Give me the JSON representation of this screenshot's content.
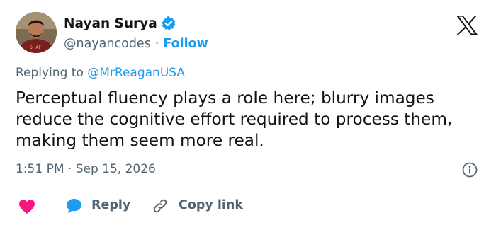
{
  "author": {
    "name": "Nayan Surya",
    "handle": "@nayancodes",
    "separator": "·",
    "follow_label": "Follow",
    "shirt_text": "SHAF"
  },
  "reply_context": {
    "prefix": "Replying to ",
    "mention": "@MrReaganUSA"
  },
  "tweet": {
    "text": "Perceptual fluency plays a role here; blurry images reduce the cognitive effort required to process them, making them seem more real.",
    "timestamp": "1:51 PM · Sep 15, 2026"
  },
  "actions": {
    "reply_label": "Reply",
    "copy_link_label": "Copy link"
  },
  "icons": {
    "verified": "verified-badge-icon",
    "x_logo": "x-logo-icon",
    "info": "info-icon",
    "like": "heart-icon",
    "reply": "speech-bubble-icon",
    "copy_link": "link-icon"
  },
  "colors": {
    "accent": "#1d9bf0",
    "like": "#f91880",
    "text": "#0f1419",
    "muted": "#536471",
    "divider": "#cfd9de"
  }
}
